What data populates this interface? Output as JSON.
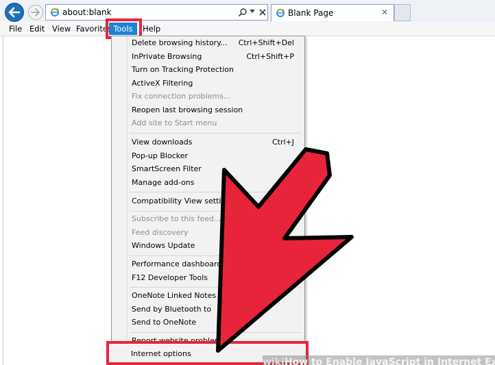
{
  "browser": {
    "address_value": "about:blank",
    "tab_title": "Blank Page",
    "tab_close_glyph": "✕",
    "back_icon": "back-arrow-icon",
    "forward_icon": "forward-arrow-icon",
    "page_icon": "ie-logo-icon"
  },
  "menu_bar": {
    "items": [
      "File",
      "Edit",
      "View",
      "Favorites",
      "Tools",
      "Help"
    ]
  },
  "tools_menu": {
    "groups": [
      [
        {
          "label": "Delete browsing history...",
          "shortcut": "Ctrl+Shift+Del",
          "enabled": true
        },
        {
          "label": "InPrivate Browsing",
          "shortcut": "Ctrl+Shift+P",
          "enabled": true
        },
        {
          "label": "Turn on Tracking Protection",
          "shortcut": "",
          "enabled": true
        },
        {
          "label": "ActiveX Filtering",
          "shortcut": "",
          "enabled": true
        },
        {
          "label": "Fix connection problems...",
          "shortcut": "",
          "enabled": false
        },
        {
          "label": "Reopen last browsing session",
          "shortcut": "",
          "enabled": true
        },
        {
          "label": "Add site to Start menu",
          "shortcut": "",
          "enabled": false
        }
      ],
      [
        {
          "label": "View downloads",
          "shortcut": "Ctrl+J",
          "enabled": true
        },
        {
          "label": "Pop-up Blocker",
          "shortcut": "",
          "enabled": true
        },
        {
          "label": "SmartScreen Filter",
          "shortcut": "",
          "enabled": true
        },
        {
          "label": "Manage add-ons",
          "shortcut": "",
          "enabled": true
        }
      ],
      [
        {
          "label": "Compatibility View settings",
          "shortcut": "",
          "enabled": true
        }
      ],
      [
        {
          "label": "Subscribe to this feed...",
          "shortcut": "",
          "enabled": false
        },
        {
          "label": "Feed discovery",
          "shortcut": "",
          "enabled": false
        },
        {
          "label": "Windows Update",
          "shortcut": "",
          "enabled": true
        }
      ],
      [
        {
          "label": "Performance dashboard",
          "shortcut": "",
          "enabled": true
        },
        {
          "label": "F12 Developer Tools",
          "shortcut": "",
          "enabled": true
        }
      ],
      [
        {
          "label": "OneNote Linked Notes",
          "shortcut": "",
          "enabled": true
        },
        {
          "label": "Send by Bluetooth to",
          "shortcut": "",
          "enabled": true
        },
        {
          "label": "Send to OneNote",
          "shortcut": "",
          "enabled": true
        }
      ],
      [
        {
          "label": "Report website problems",
          "shortcut": "",
          "enabled": true
        }
      ]
    ],
    "highlighted_item": "Internet options"
  },
  "watermark": {
    "logo": "wiki",
    "text": "How to Enable JavaScript in Internet Explorer"
  },
  "colors": {
    "highlight_red": "#e8243a",
    "tools_blue": "#1c84d3",
    "arrow_red": "#e8243a"
  }
}
